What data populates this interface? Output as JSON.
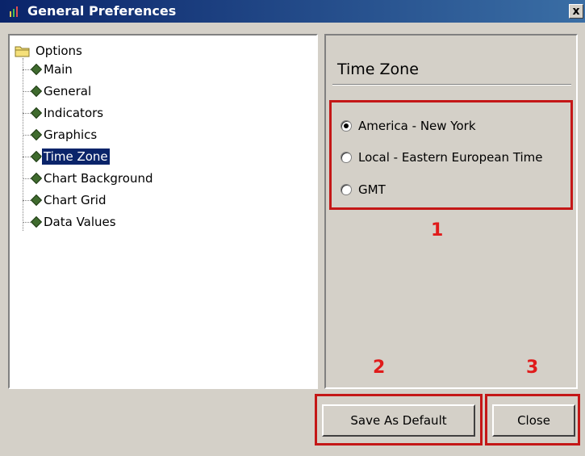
{
  "window": {
    "title": "General Preferences",
    "close_glyph": "x"
  },
  "tree": {
    "root_label": "Options",
    "items": [
      {
        "label": "Main"
      },
      {
        "label": "General"
      },
      {
        "label": "Indicators"
      },
      {
        "label": "Graphics"
      },
      {
        "label": "Time Zone",
        "selected": true
      },
      {
        "label": "Chart Background"
      },
      {
        "label": "Chart Grid"
      },
      {
        "label": "Data Values"
      }
    ]
  },
  "panel": {
    "title": "Time Zone",
    "options": [
      {
        "label": "America - New York",
        "checked": true
      },
      {
        "label": "Local - Eastern European Time",
        "checked": false
      },
      {
        "label": "GMT",
        "checked": false
      }
    ]
  },
  "buttons": {
    "save_default": "Save As Default",
    "close": "Close"
  },
  "annotations": {
    "marker1": "1",
    "marker2": "2",
    "marker3": "3",
    "color": "#e01b1b"
  },
  "icons": {
    "app": "chart-app-icon",
    "folder": "folder-icon",
    "node": "green-diamond-icon"
  }
}
